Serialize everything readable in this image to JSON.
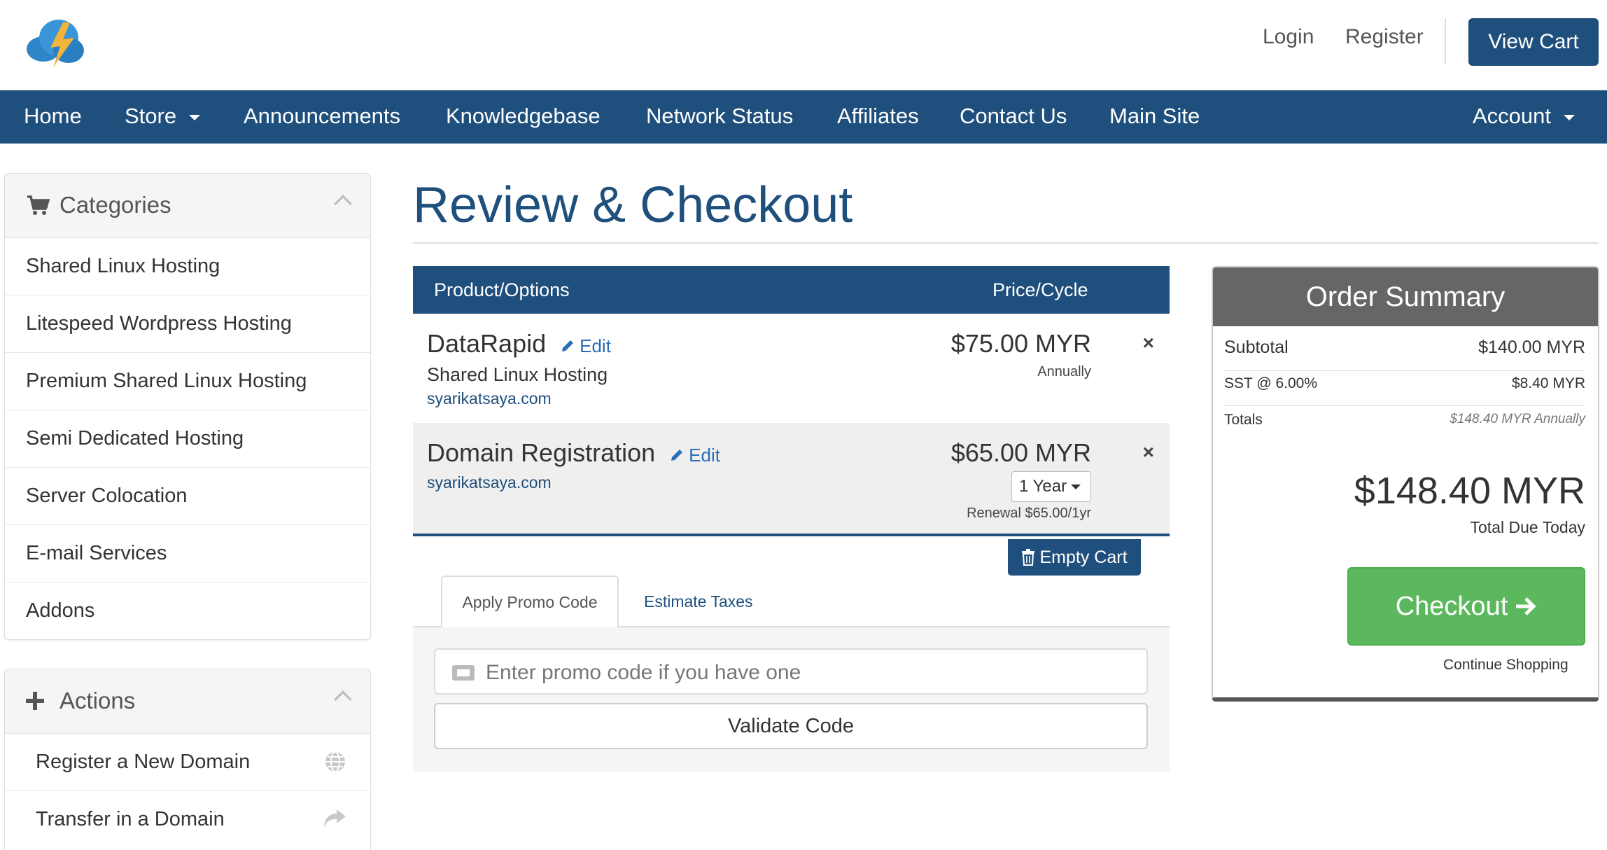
{
  "header": {
    "login": "Login",
    "register": "Register",
    "view_cart": "View Cart"
  },
  "nav": {
    "items": [
      "Home",
      "Store",
      "Announcements",
      "Knowledgebase",
      "Network Status",
      "Affiliates",
      "Contact Us",
      "Main Site"
    ],
    "account": "Account"
  },
  "sidebar": {
    "categories": {
      "title": "Categories",
      "items": [
        "Shared Linux Hosting",
        "Litespeed Wordpress Hosting",
        "Premium Shared Linux Hosting",
        "Semi Dedicated Hosting",
        "Server Colocation",
        "E-mail Services",
        "Addons"
      ]
    },
    "actions": {
      "title": "Actions",
      "items": [
        "Register a New Domain",
        "Transfer in a Domain"
      ]
    }
  },
  "page": {
    "title": "Review & Checkout"
  },
  "cart": {
    "col_product": "Product/Options",
    "col_price": "Price/Cycle",
    "items": [
      {
        "name": "DataRapid",
        "edit": "Edit",
        "group": "Shared Linux Hosting",
        "domain": "syarikatsaya.com",
        "price": "$75.00 MYR",
        "cycle": "Annually",
        "remove": "×"
      },
      {
        "name": "Domain Registration",
        "edit": "Edit",
        "domain": "syarikatsaya.com",
        "price": "$65.00 MYR",
        "period": "1 Year",
        "renewal": "Renewal $65.00/1yr",
        "remove": "×"
      }
    ],
    "empty_cart": "Empty Cart"
  },
  "promo": {
    "tab_active": "Apply Promo Code",
    "tab_other": "Estimate Taxes",
    "placeholder": "Enter promo code if you have one",
    "validate": "Validate Code"
  },
  "summary": {
    "title": "Order Summary",
    "subtotal_label": "Subtotal",
    "subtotal_value": "$140.00 MYR",
    "tax_label": "SST @ 6.00%",
    "tax_value": "$8.40 MYR",
    "totals_label": "Totals",
    "totals_value": "$148.40 MYR Annually",
    "total_due": "$148.40 MYR",
    "total_due_label": "Total Due Today",
    "checkout": "Checkout",
    "continue": "Continue Shopping"
  },
  "colors": {
    "brand": "#1f4f7c",
    "checkout": "#5cb85c",
    "link": "#2a6fb5"
  }
}
